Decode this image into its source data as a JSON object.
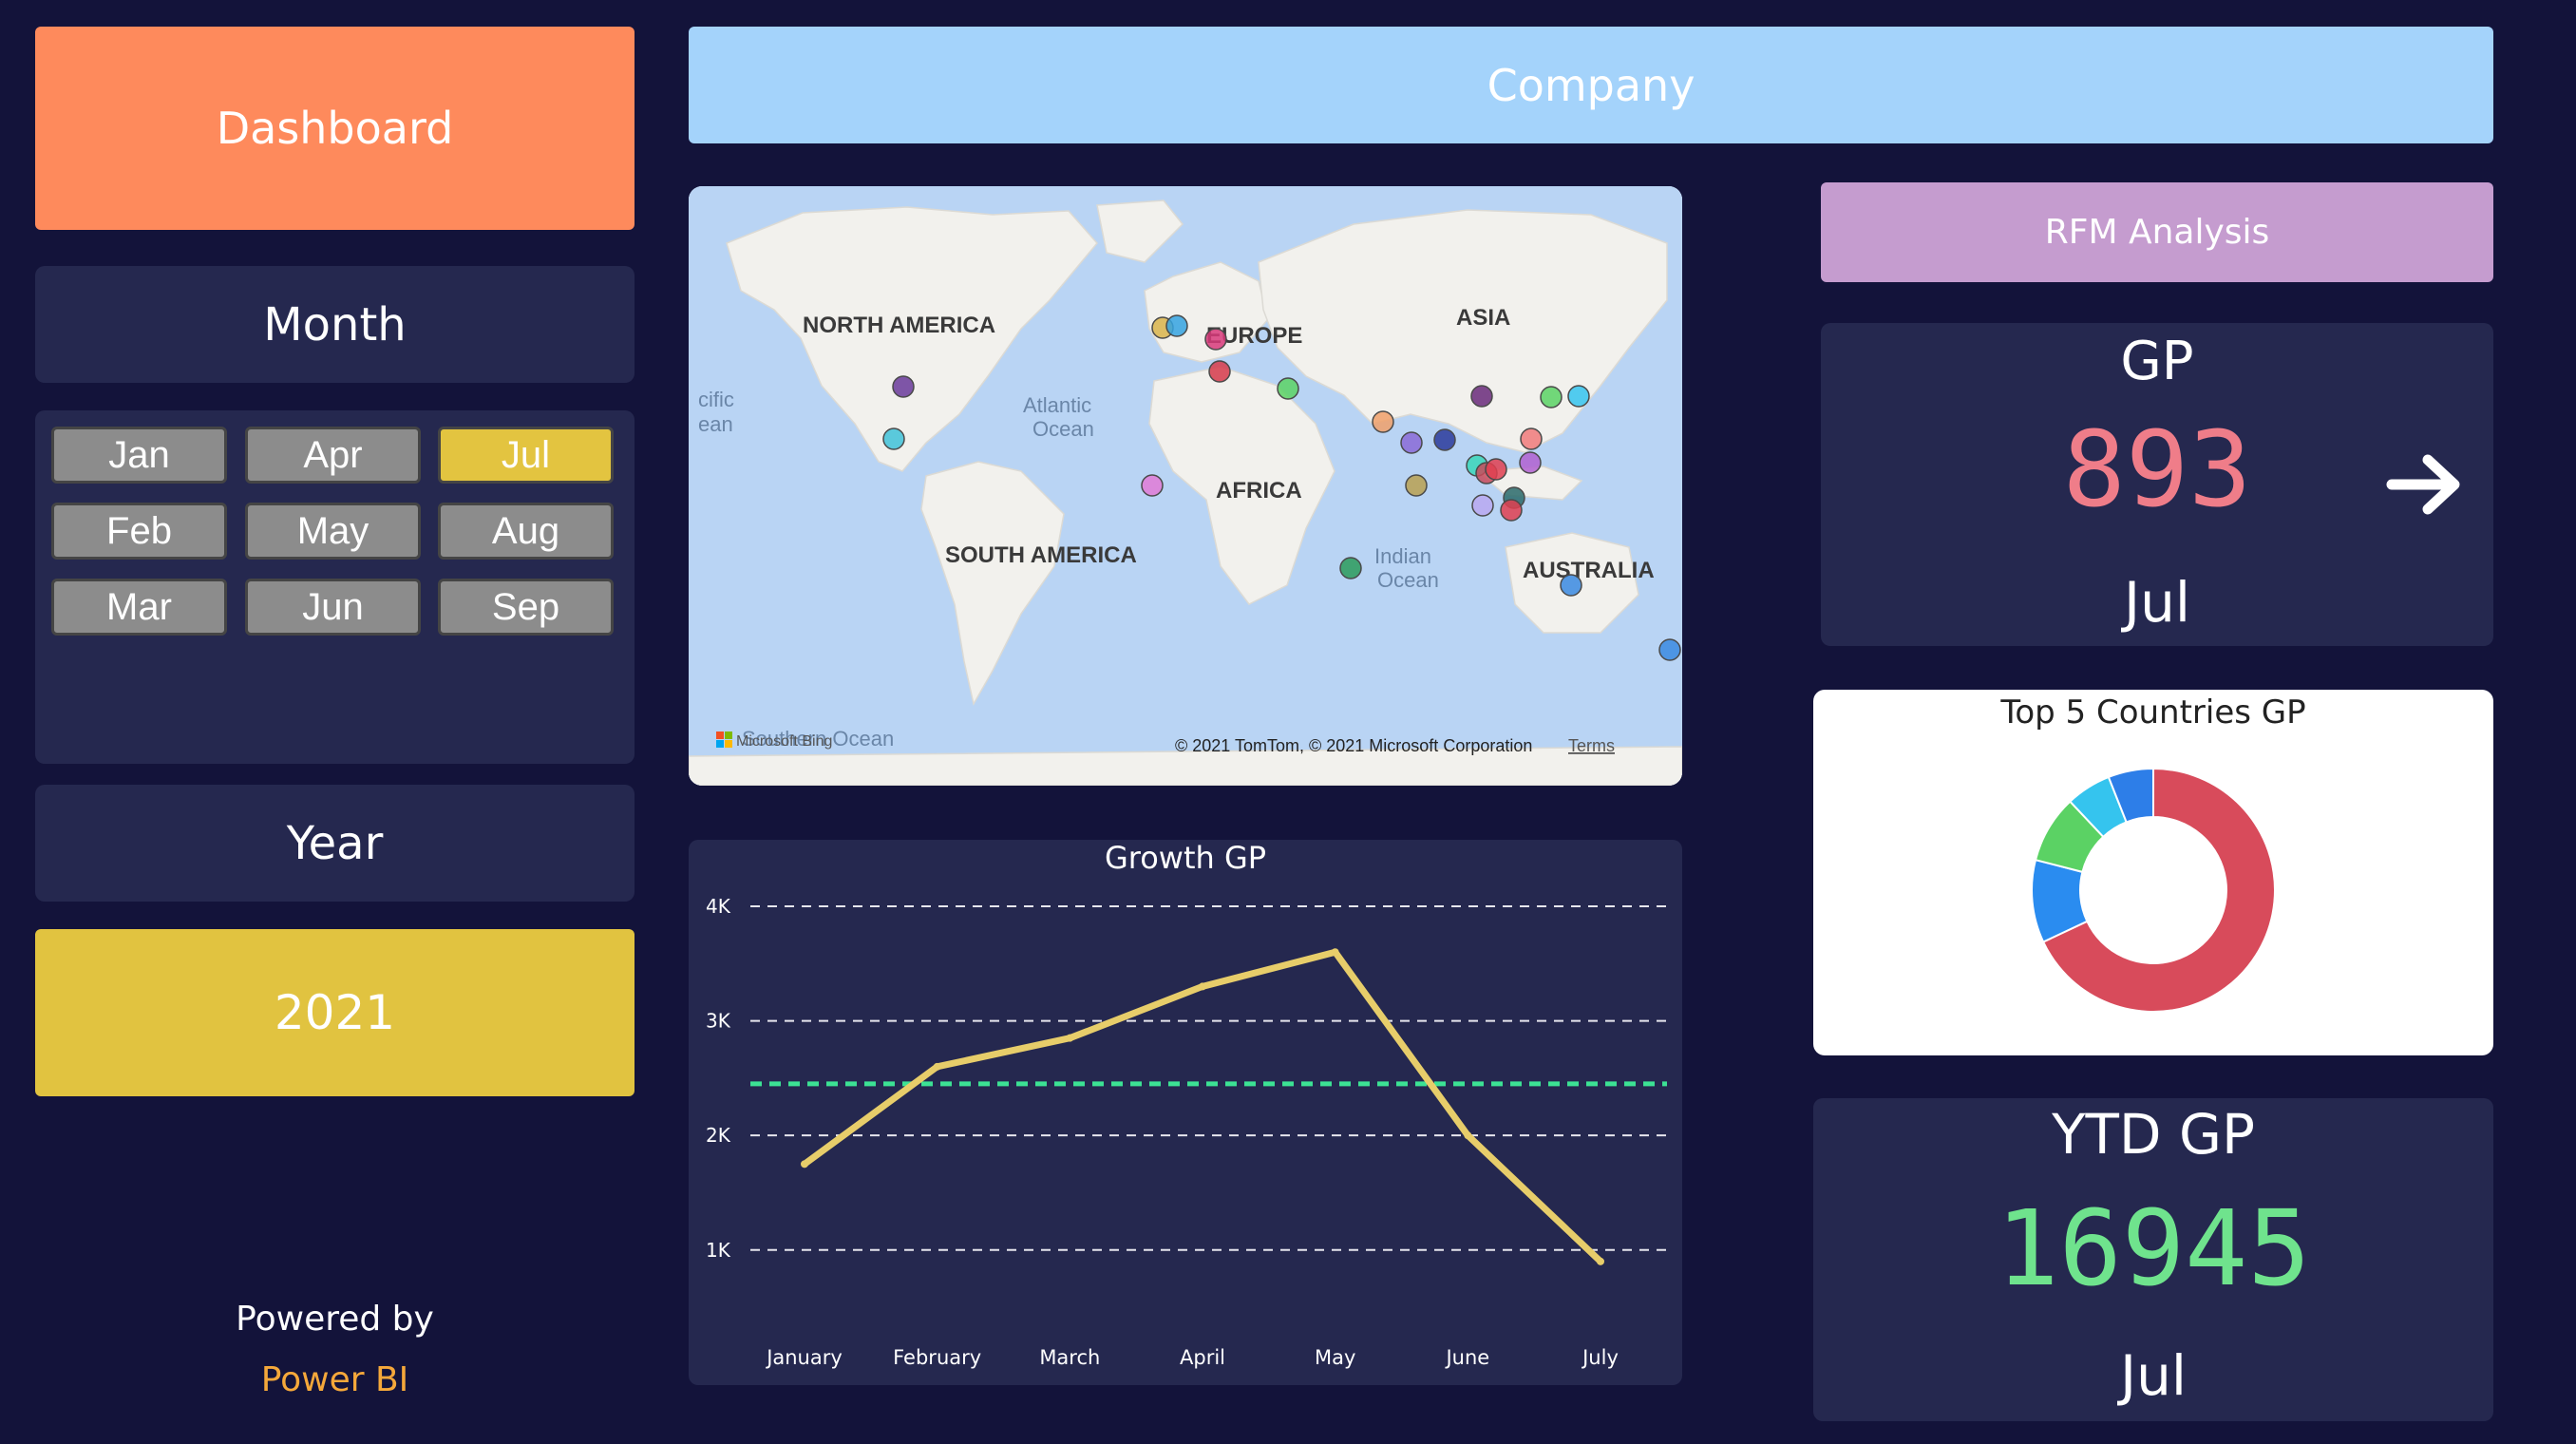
{
  "dashboard": {
    "label": "Dashboard"
  },
  "month_slicer": {
    "title": "Month",
    "buttons": [
      {
        "label": "Jan",
        "selected": false
      },
      {
        "label": "Apr",
        "selected": false
      },
      {
        "label": "Jul",
        "selected": true
      },
      {
        "label": "Feb",
        "selected": false
      },
      {
        "label": "May",
        "selected": false
      },
      {
        "label": "Aug",
        "selected": false
      },
      {
        "label": "Mar",
        "selected": false
      },
      {
        "label": "Jun",
        "selected": false
      },
      {
        "label": "Sep",
        "selected": false
      }
    ]
  },
  "year_slicer": {
    "title": "Year",
    "value": "2021"
  },
  "footer": {
    "powered_by": "Powered by",
    "brand": "Power BI"
  },
  "company_banner": {
    "label": "Company"
  },
  "map": {
    "regions": {
      "north_america": "NORTH AMERICA",
      "europe": "EUROPE",
      "asia": "ASIA",
      "africa": "AFRICA",
      "south_america": "SOUTH AMERICA",
      "australia": "AUSTRALIA"
    },
    "oceans": {
      "pacific_1": "cific",
      "pacific_2": "ean",
      "atlantic_1": "Atlantic",
      "atlantic_2": "Ocean",
      "indian_1": "Indian",
      "indian_2": "Ocean",
      "southern": "Southern Ocean"
    },
    "attribution": "© 2021 TomTom, © 2021 Microsoft Corporation",
    "terms": "Terms",
    "logo_text": "Microsoft Bing",
    "colors": {
      "water": "#b9d4f4",
      "land": "#f2f1ed"
    }
  },
  "rfm": {
    "label": "RFM Analysis",
    "color": "#c59ccf"
  },
  "gp": {
    "title": "GP",
    "value": "893",
    "month": "Jul",
    "value_color": "#ef7d89",
    "arrow_icon": "arrow-right-icon"
  },
  "top5": {
    "title": "Top 5 Countries GP"
  },
  "ytd": {
    "title": "YTD GP",
    "value": "16945",
    "month": "Jul",
    "value_color": "#6fe38d"
  },
  "chart_data": [
    {
      "type": "line",
      "title": "Growth GP",
      "categories": [
        "January",
        "February",
        "March",
        "April",
        "May",
        "June",
        "July"
      ],
      "series": [
        {
          "values": [
            1750,
            2600,
            2850,
            3300,
            3600,
            2000,
            900
          ],
          "color": "#e7cd6a"
        }
      ],
      "reference_line": {
        "value": 2450,
        "color": "#3ce294",
        "style": "dashed"
      },
      "yticks": [
        {
          "value": 1000,
          "label": "1K"
        },
        {
          "value": 2000,
          "label": "2K"
        },
        {
          "value": 3000,
          "label": "3K"
        },
        {
          "value": 4000,
          "label": "4K"
        }
      ],
      "ylim": [
        600,
        4000
      ],
      "grid": true
    },
    {
      "type": "pie",
      "variant": "donut",
      "title": "Top 5 Countries GP",
      "slices": [
        {
          "value": 68,
          "color": "#d84b5b"
        },
        {
          "value": 11,
          "color": "#2a8cf0"
        },
        {
          "value": 9,
          "color": "#5bd264"
        },
        {
          "value": 6,
          "color": "#35c4ee"
        },
        {
          "value": 6,
          "color": "#2d7ee8"
        }
      ]
    }
  ]
}
